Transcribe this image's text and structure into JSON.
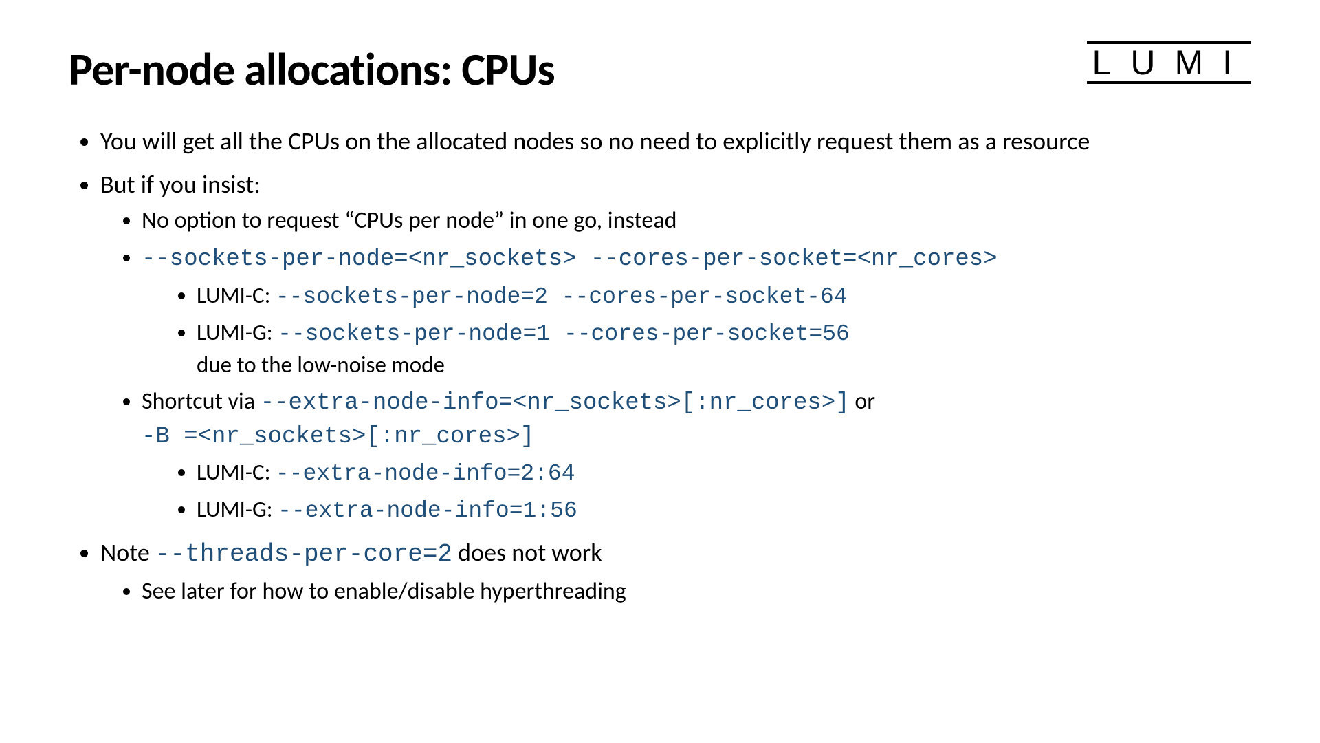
{
  "logo": "LUMI",
  "title": "Per-node allocations: CPUs",
  "b1": "You will get all the CPUs on the allocated nodes so no need to explicitly request them as a resource",
  "b2": "But if you insist:",
  "b2_1": "No option to request “CPUs per node” in one go, instead",
  "b2_2_code": "--sockets-per-node=<nr_sockets> --cores-per-socket=<nr_cores>",
  "b2_2_1_pre": "LUMI-C: ",
  "b2_2_1_code": "--sockets-per-node=2 --cores-per-socket-64",
  "b2_2_2_pre": "LUMI-G: ",
  "b2_2_2_code": "--sockets-per-node=1 --cores-per-socket=56",
  "b2_2_2_post": "due to the low-noise mode",
  "b2_3_pre": "Shortcut via ",
  "b2_3_code1": "--extra-node-info=<nr_sockets>[:nr_cores>]",
  "b2_3_mid": " or",
  "b2_3_code2": "-B =<nr_sockets>[:nr_cores>]",
  "b2_3_1_pre": "LUMI-C: ",
  "b2_3_1_code": "--extra-node-info=2:64",
  "b2_3_2_pre": "LUMI-G: ",
  "b2_3_2_code": "--extra-node-info=1:56",
  "b3_pre": "Note ",
  "b3_code": "--threads-per-core=2",
  "b3_post": " does not work",
  "b3_1": "See later for how to enable/disable hyperthreading"
}
